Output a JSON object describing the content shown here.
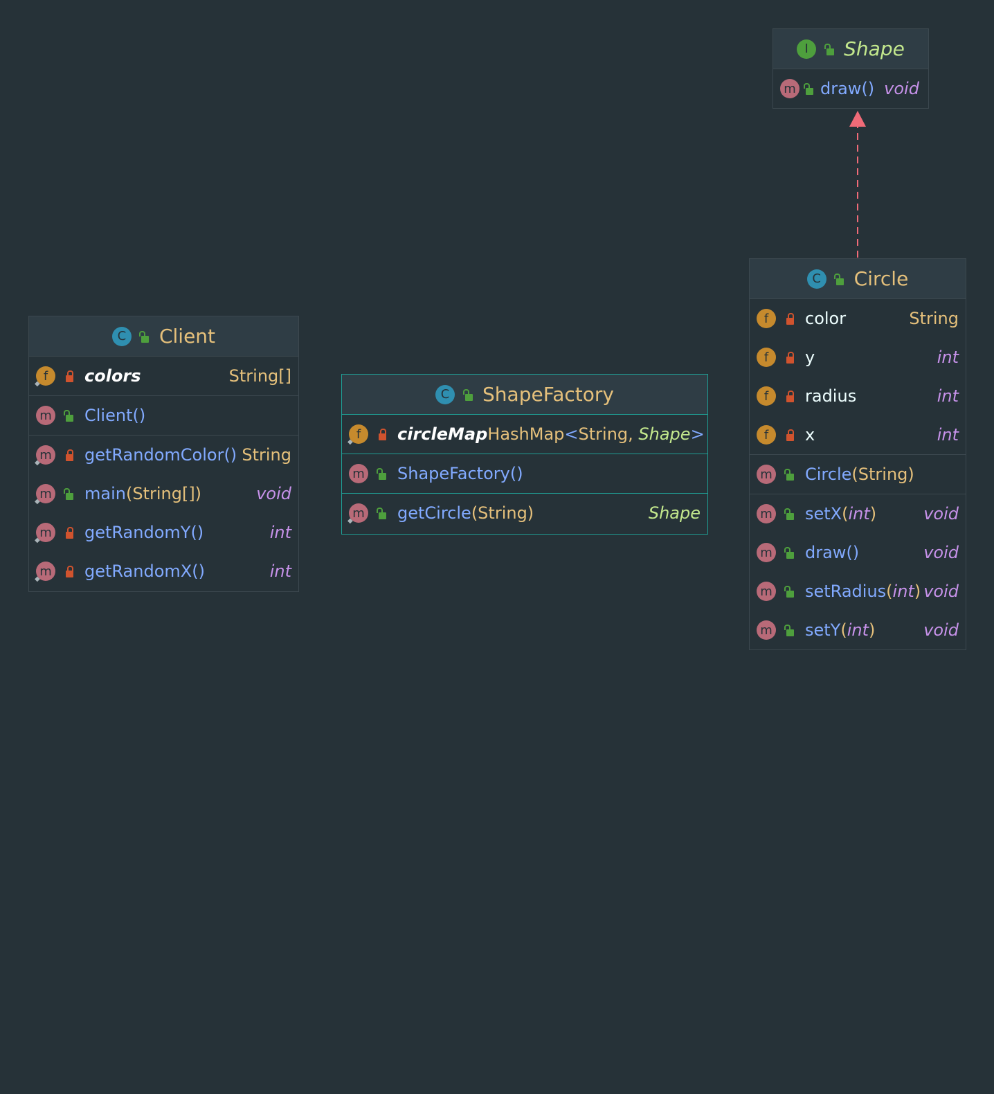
{
  "shape": {
    "badge": "I",
    "title": "Shape",
    "methods": [
      {
        "badge": "m",
        "name": "draw",
        "params": "()",
        "type": "void"
      }
    ]
  },
  "circle": {
    "badge": "C",
    "title": "Circle",
    "fields": [
      {
        "badge": "f",
        "name": "color",
        "type": "String"
      },
      {
        "badge": "f",
        "name": "y",
        "type": "int"
      },
      {
        "badge": "f",
        "name": "radius",
        "type": "int"
      },
      {
        "badge": "f",
        "name": "x",
        "type": "int"
      }
    ],
    "constructor": {
      "badge": "m",
      "name": "Circle",
      "params": "(String)"
    },
    "methods": [
      {
        "badge": "m",
        "name": "setX",
        "open": "(",
        "param": "int",
        "close": ")",
        "type": "void"
      },
      {
        "badge": "m",
        "name": "draw",
        "params": "()",
        "type": "void"
      },
      {
        "badge": "m",
        "name": "setRadius",
        "open": "(",
        "param": "int",
        "close": ")",
        "type": "void"
      },
      {
        "badge": "m",
        "name": "setY",
        "open": "(",
        "param": "int",
        "close": ")",
        "type": "void"
      }
    ]
  },
  "client": {
    "badge": "C",
    "title": "Client",
    "fields": [
      {
        "badge": "f",
        "name": "colors",
        "type": "String[]"
      }
    ],
    "constructor": {
      "badge": "m",
      "name": "Client",
      "params": "()"
    },
    "methods": [
      {
        "badge": "m",
        "name": "getRandomColor",
        "params": " ()",
        "type": "String"
      },
      {
        "badge": "m",
        "name": "main",
        "params": "(String[])",
        "type": "void"
      },
      {
        "badge": "m",
        "name": "getRandomY",
        "params": " ()",
        "type": "int"
      },
      {
        "badge": "m",
        "name": "getRandomX",
        "params": " ()",
        "type": "int"
      }
    ]
  },
  "factory": {
    "badge": "C",
    "title": "ShapeFactory",
    "fields": [
      {
        "badge": "f",
        "name": "circleMap",
        "type_base": "HashMap",
        "type_lt": "<",
        "type_arg1": "String, ",
        "type_arg2": "Shape",
        "type_gt": ">"
      }
    ],
    "constructor": {
      "badge": "m",
      "name": "ShapeFactory",
      "params": " ()"
    },
    "methods": [
      {
        "badge": "m",
        "name": "getCircle",
        "params": " (String)",
        "type": "Shape"
      }
    ]
  },
  "colors": {
    "background": "#263238",
    "header": "#2f3d45",
    "class_title": "#e5c07b",
    "interface_title": "#c3e88d",
    "method_name": "#82aaff",
    "primitive_type": "#c792ea",
    "arrow": "#f06b78",
    "selected_border": "#1f9e94"
  },
  "icons": {
    "private": "lock-icon",
    "public": "unlock-icon",
    "static_marker": "pin-icon"
  }
}
